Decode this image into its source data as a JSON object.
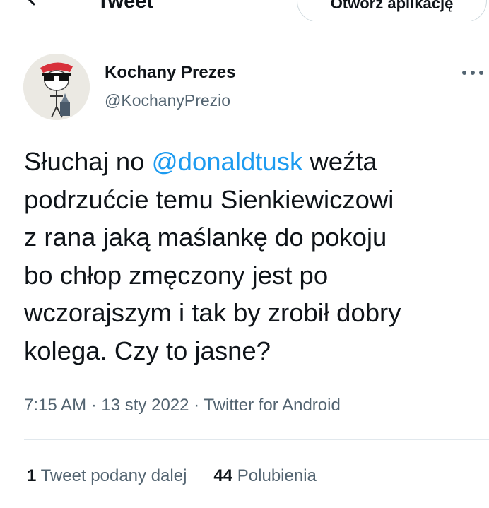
{
  "header": {
    "title": "Tweet",
    "open_app_label": "Otwórz aplikację"
  },
  "author": {
    "display_name": "Kochany Prezes",
    "handle": "@KochanyPrezio"
  },
  "tweet": {
    "text_1": "Słuchaj no ",
    "mention": "@donaldtusk",
    "text_2": " weźta\npodrzućcie temu Sienkiewiczowi\nz rana jaką maślankę do pokoju\nbo chłop zmęczony jest po\nwczorajszym i tak by zrobił dobry\nkolega. Czy to jasne?"
  },
  "meta": {
    "time": "7:15 AM",
    "separator": " · ",
    "date": "13 sty 2022",
    "source": "Twitter for Android"
  },
  "stats": {
    "retweets_count": "1",
    "retweets_label": "Tweet podany dalej",
    "likes_count": "44",
    "likes_label": "Polubienia"
  },
  "colors": {
    "accent": "#1d9bf0",
    "secondary_text": "#536471",
    "primary_text": "#0f1419",
    "divider": "#e1e8ed"
  },
  "icons": {
    "back": "arrow-left-icon",
    "more": "more-horizontal-icon"
  }
}
